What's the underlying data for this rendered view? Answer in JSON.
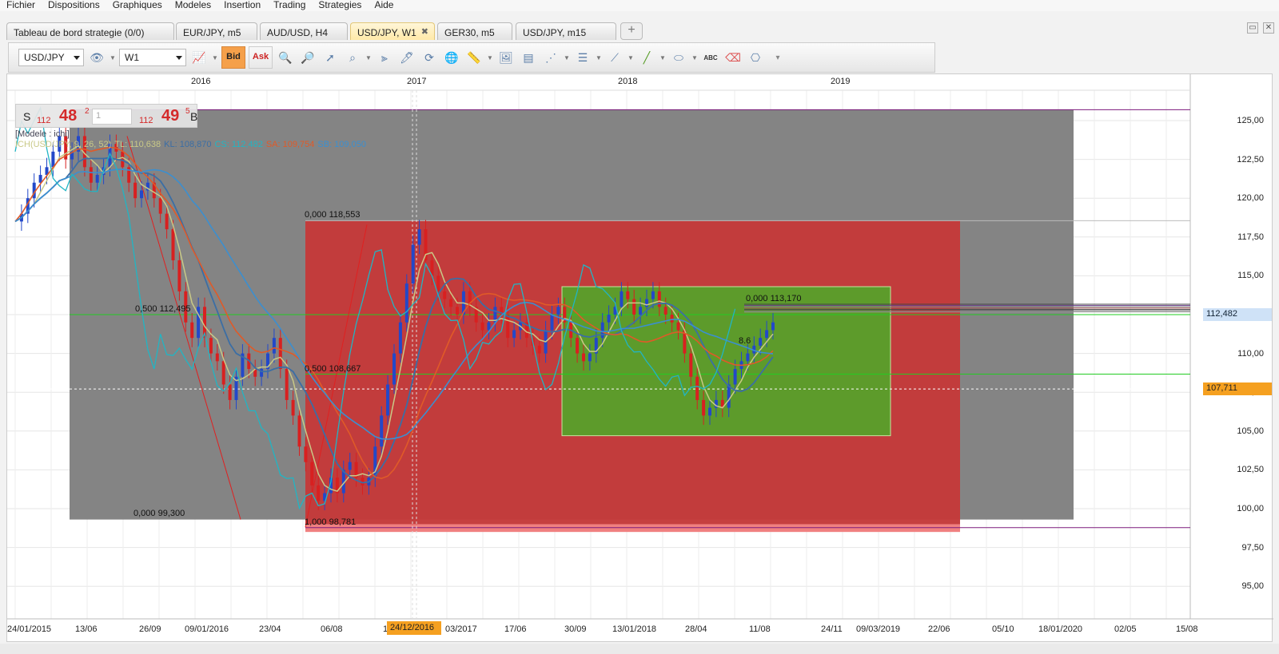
{
  "menu": [
    "Fichier",
    "Dispositions",
    "Graphiques",
    "Modeles",
    "Insertion",
    "Trading",
    "Strategies",
    "Aide"
  ],
  "tabs": [
    {
      "label": "Tableau de bord strategie (0/0)",
      "active": false
    },
    {
      "label": "EUR/JPY, m5",
      "active": false
    },
    {
      "label": "AUD/USD, H4",
      "active": false
    },
    {
      "label": "USD/JPY, W1",
      "active": true
    },
    {
      "label": "GER30, m5",
      "active": false
    },
    {
      "label": "USD/JPY, m15",
      "active": false
    }
  ],
  "tab_close": "✖",
  "add_tab": "+",
  "window_buttons": [
    "▭",
    "✕"
  ],
  "toolbar": {
    "symbol": "USD/JPY",
    "timeframe": "W1",
    "bid": "Bid",
    "ask": "Ask",
    "abc": "ABC"
  },
  "price_panel": {
    "sell": "S",
    "buy": "B",
    "sell_small": "112",
    "sell_big": "48",
    "sell_sup": "2",
    "buy_small": "112",
    "buy_big": "49",
    "buy_sup": "5",
    "quantity": "1"
  },
  "model_label": "[Modele : ichi]",
  "indicator_legend": [
    {
      "text": "ICH(USD/JPY, 9, 26, 52)",
      "color": "#c9c987"
    },
    {
      "text": "TL: 110,638",
      "color": "#c9c987"
    },
    {
      "text": "KL: 108,870",
      "color": "#3b6ea5"
    },
    {
      "text": "CS: 112,482",
      "color": "#21b5c4"
    },
    {
      "text": "SA: 109,754",
      "color": "#e05a28"
    },
    {
      "text": "SB: 109,050",
      "color": "#3b8fd0"
    }
  ],
  "fib_labels": [
    "0,000 118,553",
    "0,500 112,495",
    "0,500 108,667",
    "0,000 99,300",
    "1,000 98,781",
    "0,000 113,170",
    "8.6"
  ],
  "top_years": [
    "2016",
    "2017",
    "2018",
    "2019"
  ],
  "bottom_dates": [
    "24/01/2015",
    "13/06",
    "26/09",
    "09/01/2016",
    "23/04",
    "06/08",
    "19/11",
    "03/2017",
    "17/06",
    "30/09",
    "13/01/2018",
    "28/04",
    "11/08",
    "24/11",
    "09/03/2019",
    "22/06",
    "05/10",
    "18/01/2020",
    "02/05",
    "15/08"
  ],
  "crosshair_date": "24/12/2016",
  "y_ticks": [
    "125,00",
    "122,50",
    "120,00",
    "117,50",
    "115,00",
    "112,50",
    "110,00",
    "107,50",
    "105,00",
    "102,50",
    "100,00",
    "97,50",
    "95,00"
  ],
  "price_tags": [
    {
      "value": "112,482",
      "bg": "#cfe2f7",
      "color": "#123"
    },
    {
      "value": "107,711",
      "bg": "#f5a020",
      "color": "#222"
    }
  ],
  "colors": {
    "tenkan": "#c9c987",
    "kijun": "#3b6ea5",
    "chikou": "#21b5c4",
    "senkou_a": "#e05a28",
    "senkou_b": "#3b8fd0",
    "bull": "#2348c9",
    "bear": "#d82020",
    "fib_red": "#c43a3a",
    "fib_green": "#5a9e2a",
    "fib_gray": "#808080"
  }
}
